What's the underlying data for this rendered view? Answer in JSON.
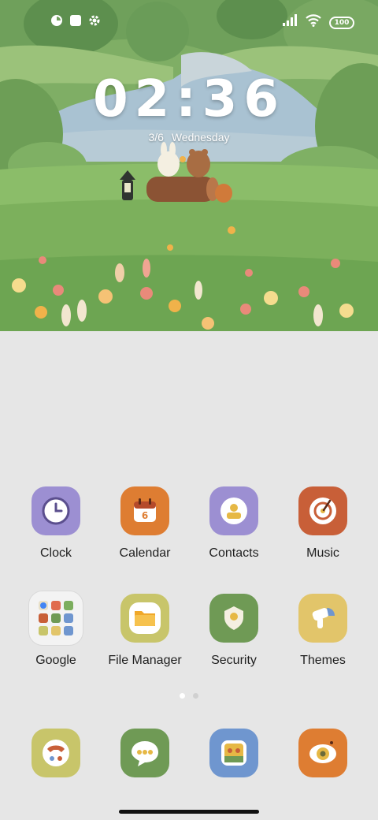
{
  "status_bar": {
    "left_icons": [
      "notification-app-icon",
      "square-notification-icon",
      "settings-gear-icon"
    ],
    "right_icons": [
      "signal-icon",
      "wifi-icon"
    ],
    "battery_level": "100"
  },
  "clock_widget": {
    "time": "02:36",
    "date": "3/6",
    "weekday": "Wednesday"
  },
  "apps_row1": [
    {
      "label": "Clock",
      "icon": "clock-icon",
      "bg": "#c9813c",
      "color": "#9c8fd2"
    },
    {
      "label": "Calendar",
      "icon": "calendar-icon",
      "color": "#de7d32"
    },
    {
      "label": "Contacts",
      "icon": "contacts-icon",
      "color": "#9c8fd2"
    },
    {
      "label": "Music",
      "icon": "music-icon",
      "color": "#c85f38"
    }
  ],
  "apps_row2": [
    {
      "label": "Google",
      "icon": "google-folder-icon",
      "color": "#f3f3f3"
    },
    {
      "label": "File Manager",
      "icon": "file-manager-icon",
      "color": "#c8c56a"
    },
    {
      "label": "Security",
      "icon": "security-icon",
      "color": "#6f9a55"
    },
    {
      "label": "Themes",
      "icon": "themes-icon",
      "color": "#e2c56a"
    }
  ],
  "calendar_day": "6",
  "dock": [
    {
      "icon": "phone-icon",
      "color": "#c8c56a"
    },
    {
      "icon": "messages-icon",
      "color": "#6f9a55"
    },
    {
      "icon": "gallery-icon",
      "color": "#6f96cf"
    },
    {
      "icon": "camera-icon",
      "color": "#de7d32"
    }
  ],
  "page_indicator": {
    "pages": 2,
    "current": 1
  }
}
